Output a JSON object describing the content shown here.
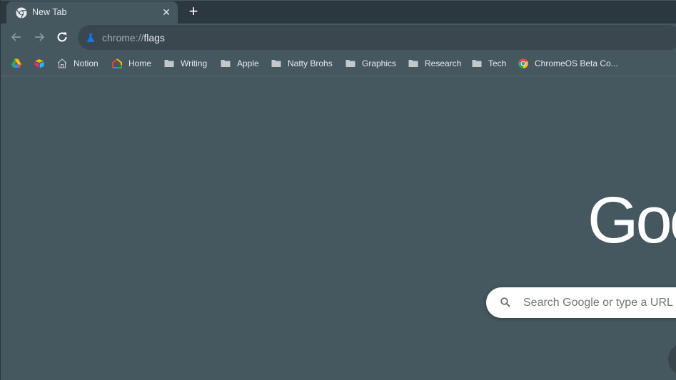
{
  "tabs": [
    {
      "title": "New Tab",
      "favicon": "chrome-icon",
      "active": true
    }
  ],
  "tab_actions": {
    "close_label": "✕",
    "new_tab_label": "+"
  },
  "toolbar": {
    "back_icon": "arrow-left-icon",
    "forward_icon": "arrow-right-icon",
    "reload_icon": "reload-icon"
  },
  "omnibox": {
    "scheme": "chrome://",
    "host": "flags",
    "icon": "flask-icon"
  },
  "bookmarks": [
    {
      "label": "",
      "icon": "google-drive-icon"
    },
    {
      "label": "",
      "icon": "airtable-icon"
    },
    {
      "label": "Notion",
      "icon": "home-outline-icon"
    },
    {
      "label": "Home",
      "icon": "google-home-icon"
    },
    {
      "label": "Writing",
      "icon": "folder-icon"
    },
    {
      "label": "Apple",
      "icon": "folder-icon"
    },
    {
      "label": "Natty Brohs",
      "icon": "folder-icon"
    },
    {
      "label": "Graphics",
      "icon": "folder-icon"
    },
    {
      "label": "Research",
      "icon": "folder-icon"
    },
    {
      "label": "Tech",
      "icon": "folder-icon"
    },
    {
      "label": "ChromeOS Beta Co...",
      "icon": "chrome-icon"
    }
  ],
  "ntp": {
    "logo_text": "Goo",
    "search_placeholder": "Search Google or type a URL"
  },
  "colors": {
    "tabstrip": "#2d383e",
    "toolbar": "#45575f",
    "omnibox": "#3a474e",
    "accent_blue": "#1a73e8"
  }
}
